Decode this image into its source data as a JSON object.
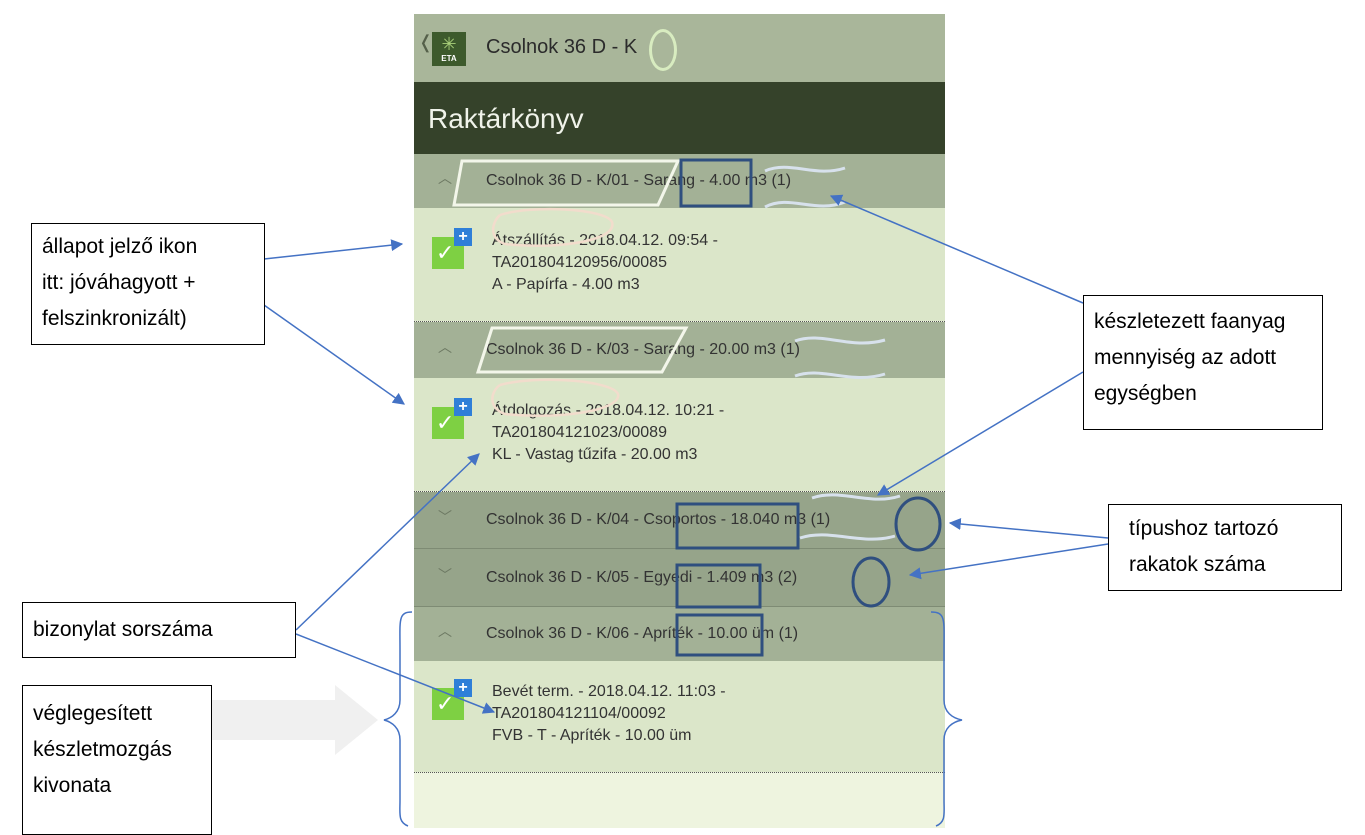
{
  "app": {
    "back_glyph": "❬",
    "logo_label": "ETA",
    "logo_icon": "tree-icon",
    "title": "Csolnok 36 D - K",
    "header": "Raktárkönyv"
  },
  "groups": [
    {
      "chevron": "^",
      "text": "Csolnok 36 D - K/01 - Sarang - 4.00 m3 (1)"
    },
    {
      "chevron": "^",
      "text": "Csolnok 36 D - K/03 - Sarang - 20.00 m3 (1)"
    },
    {
      "chevron": "v",
      "text": "Csolnok 36 D - K/04 - Csoportos - 18.040 m3 (1)"
    },
    {
      "chevron": "v",
      "text": "Csolnok 36 D - K/05 - Egyedi - 1.409 m3 (2)"
    },
    {
      "chevron": "^",
      "text": "Csolnok 36 D - K/06 - Apríték - 10.00 üm (1)"
    }
  ],
  "entries": [
    {
      "line1": "Átszállítás - 2018.04.12. 09:54 -",
      "line2": "TA201804120956/00085",
      "line3": "A - Papírfa - 4.00 m3"
    },
    {
      "line1": "Átdolgozás - 2018.04.12. 10:21 -",
      "line2": "TA201804121023/00089",
      "line3": "KL - Vastag tűzifa - 20.00 m3"
    },
    {
      "line1": "Bevét term. - 2018.04.12. 11:03 -",
      "line2": "TA201804121104/00092",
      "line3": "FVB - T - Apríték - 10.00 üm"
    }
  ],
  "callouts": {
    "status_icon": [
      "állapot jelző ikon",
      "itt: jóváhagyott +",
      "felszinkronizált)"
    ],
    "quantity": [
      "készletezett faanyag",
      "mennyiség az adott",
      "egységben"
    ],
    "stack_count": [
      "típushoz tartozó",
      "rakatok száma"
    ],
    "doc_number": [
      "bizonylat sorszáma"
    ],
    "finalized": [
      "véglegesített",
      "készletmozgás",
      "kivonata"
    ]
  },
  "colors": {
    "topbar": "#a9b69a",
    "header": "#35422a",
    "group_row": "#a3b196",
    "entry_row": "#dbe6c9",
    "status_green": "#7ed043",
    "sync_blue": "#2f7fd8",
    "annotation_blue": "#4472c4",
    "highlight_box": "#2f4f7f"
  }
}
